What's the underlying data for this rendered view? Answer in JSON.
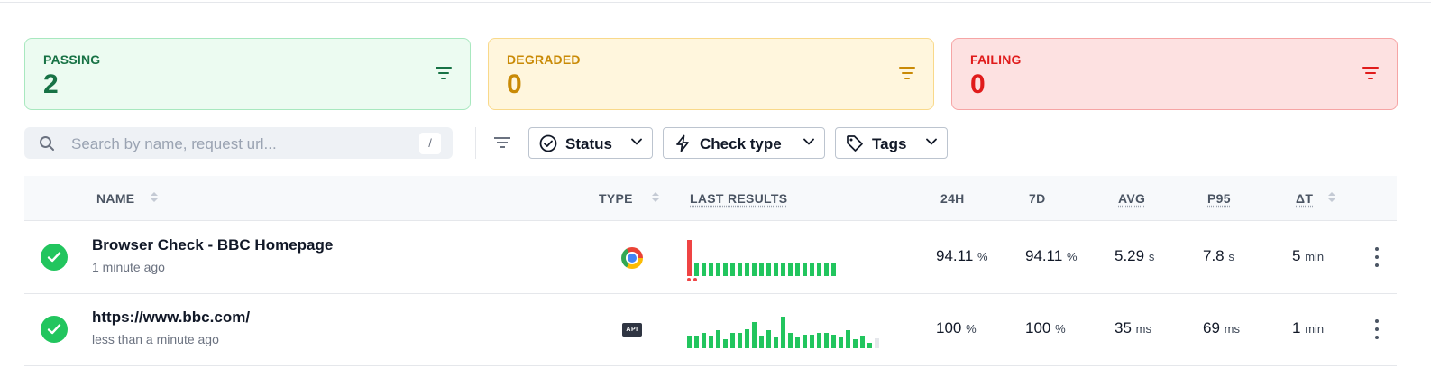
{
  "summary": {
    "passing": {
      "label": "PASSING",
      "count": "2"
    },
    "degraded": {
      "label": "DEGRADED",
      "count": "0"
    },
    "failing": {
      "label": "FAILING",
      "count": "0"
    }
  },
  "toolbar": {
    "search_placeholder": "Search by name, request url...",
    "search_shortcut": "/",
    "filters": [
      {
        "label": "Status",
        "icon": "circle-check-icon"
      },
      {
        "label": "Check type",
        "icon": "lightning-icon"
      },
      {
        "label": "Tags",
        "icon": "tag-icon"
      }
    ]
  },
  "table": {
    "columns": {
      "name": "NAME",
      "type": "TYPE",
      "last_results": "LAST RESULTS",
      "h24": "24H",
      "d7": "7D",
      "avg": "AVG",
      "p95": "P95",
      "delta_t": "ΔT"
    },
    "rows": [
      {
        "name": "Browser Check - BBC Homepage",
        "time": "1 minute ago",
        "type_icon": "chrome-icon",
        "status": "passing",
        "h24": "94.11",
        "h24_unit": "%",
        "d7": "94.11",
        "d7_unit": "%",
        "avg": "5.29",
        "avg_unit": "s",
        "p95": "7.8",
        "p95_unit": "s",
        "delta_t": "5",
        "delta_t_unit": "min",
        "results": [
          {
            "v": 1.0,
            "s": "fail"
          },
          {
            "v": 0.38,
            "s": "pass"
          },
          {
            "v": 0.38,
            "s": "pass"
          },
          {
            "v": 0.38,
            "s": "pass"
          },
          {
            "v": 0.38,
            "s": "pass"
          },
          {
            "v": 0.38,
            "s": "pass"
          },
          {
            "v": 0.38,
            "s": "pass"
          },
          {
            "v": 0.38,
            "s": "pass"
          },
          {
            "v": 0.38,
            "s": "pass"
          },
          {
            "v": 0.38,
            "s": "pass"
          },
          {
            "v": 0.38,
            "s": "pass"
          },
          {
            "v": 0.38,
            "s": "pass"
          },
          {
            "v": 0.38,
            "s": "pass"
          },
          {
            "v": 0.38,
            "s": "pass"
          },
          {
            "v": 0.38,
            "s": "pass"
          },
          {
            "v": 0.38,
            "s": "pass"
          },
          {
            "v": 0.38,
            "s": "pass"
          },
          {
            "v": 0.38,
            "s": "pass"
          },
          {
            "v": 0.38,
            "s": "pass"
          },
          {
            "v": 0.38,
            "s": "pass"
          },
          {
            "v": 0.38,
            "s": "pass"
          }
        ],
        "failure_markers": 2
      },
      {
        "name": "https://www.bbc.com/",
        "time": "less than a minute ago",
        "type_icon": "api-icon",
        "status": "passing",
        "h24": "100",
        "h24_unit": "%",
        "d7": "100",
        "d7_unit": "%",
        "avg": "35",
        "avg_unit": "ms",
        "p95": "69",
        "p95_unit": "ms",
        "delta_t": "1",
        "delta_t_unit": "min",
        "results": [
          {
            "v": 0.35,
            "s": "pass"
          },
          {
            "v": 0.35,
            "s": "pass"
          },
          {
            "v": 0.42,
            "s": "pass"
          },
          {
            "v": 0.35,
            "s": "pass"
          },
          {
            "v": 0.5,
            "s": "pass"
          },
          {
            "v": 0.25,
            "s": "pass"
          },
          {
            "v": 0.42,
            "s": "pass"
          },
          {
            "v": 0.42,
            "s": "pass"
          },
          {
            "v": 0.52,
            "s": "pass"
          },
          {
            "v": 0.72,
            "s": "pass"
          },
          {
            "v": 0.35,
            "s": "pass"
          },
          {
            "v": 0.5,
            "s": "pass"
          },
          {
            "v": 0.3,
            "s": "pass"
          },
          {
            "v": 0.88,
            "s": "pass"
          },
          {
            "v": 0.42,
            "s": "pass"
          },
          {
            "v": 0.3,
            "s": "pass"
          },
          {
            "v": 0.38,
            "s": "pass"
          },
          {
            "v": 0.38,
            "s": "pass"
          },
          {
            "v": 0.42,
            "s": "pass"
          },
          {
            "v": 0.42,
            "s": "pass"
          },
          {
            "v": 0.38,
            "s": "pass"
          },
          {
            "v": 0.3,
            "s": "pass"
          },
          {
            "v": 0.5,
            "s": "pass"
          },
          {
            "v": 0.25,
            "s": "pass"
          },
          {
            "v": 0.35,
            "s": "pass"
          },
          {
            "v": 0.15,
            "s": "pass"
          },
          {
            "v": 0.28,
            "s": "none"
          }
        ],
        "failure_markers": 0
      }
    ]
  },
  "colors": {
    "pass": "#22c55e",
    "fail": "#ef4444",
    "none": "#e5e7eb"
  }
}
